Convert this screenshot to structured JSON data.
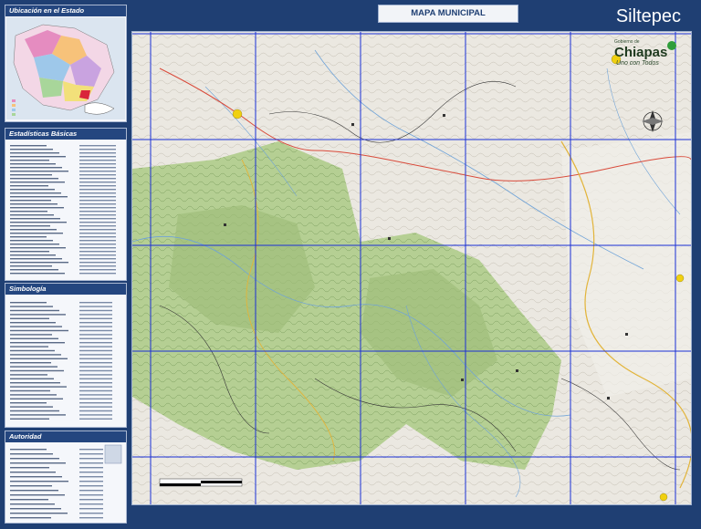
{
  "header": {
    "map_title": "MAPA MUNICIPAL",
    "municipality": "Siltepec"
  },
  "sidebar": {
    "location_title": "Ubicación en el Estado",
    "stats_title": "Estadísticas Básicas",
    "symbology_title": "Simbología",
    "authority_title": "Autoridad"
  },
  "brand": {
    "line1": "Gobierno de",
    "line2": "Chiapas",
    "line3": "Uno con Todos"
  },
  "colors": {
    "frame": "#1f3f73",
    "panel_title": "#24467f",
    "grid": "#1a2fd6",
    "forest": "#a9c98a",
    "terrain": "#e8e6df"
  },
  "map": {
    "grid_cols": 5,
    "grid_rows": 4
  }
}
